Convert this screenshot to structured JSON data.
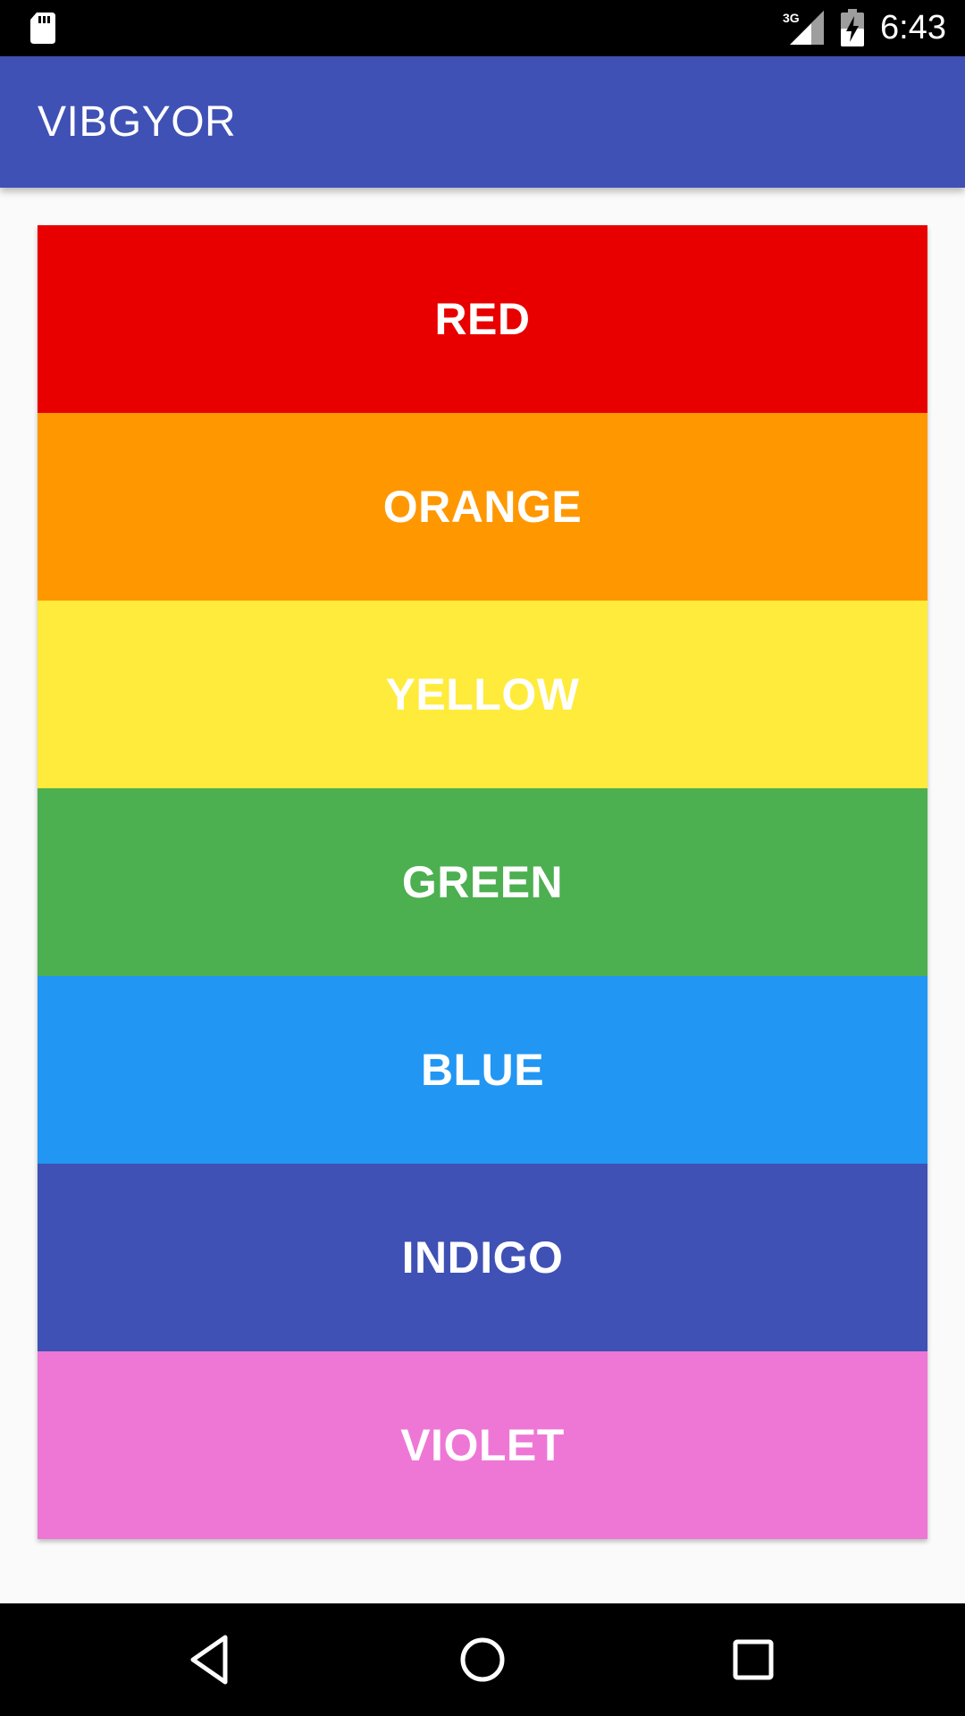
{
  "status_bar": {
    "network": "3G",
    "time": "6:43",
    "icons": [
      "sd-card-icon",
      "signal-3g-icon",
      "battery-charging-icon"
    ]
  },
  "app_bar": {
    "title": "VIBGYOR",
    "color": "#3f51b5"
  },
  "colors": [
    {
      "label": "RED",
      "color": "#e80000"
    },
    {
      "label": "ORANGE",
      "color": "#ff9800"
    },
    {
      "label": "YELLOW",
      "color": "#ffeb3b"
    },
    {
      "label": "GREEN",
      "color": "#4caf50"
    },
    {
      "label": "BLUE",
      "color": "#2196f3"
    },
    {
      "label": "INDIGO",
      "color": "#3f51b5"
    },
    {
      "label": "VIOLET",
      "color": "#ee77d6"
    }
  ],
  "nav_bar": {
    "icons": [
      "back-icon",
      "home-icon",
      "recents-icon"
    ]
  }
}
